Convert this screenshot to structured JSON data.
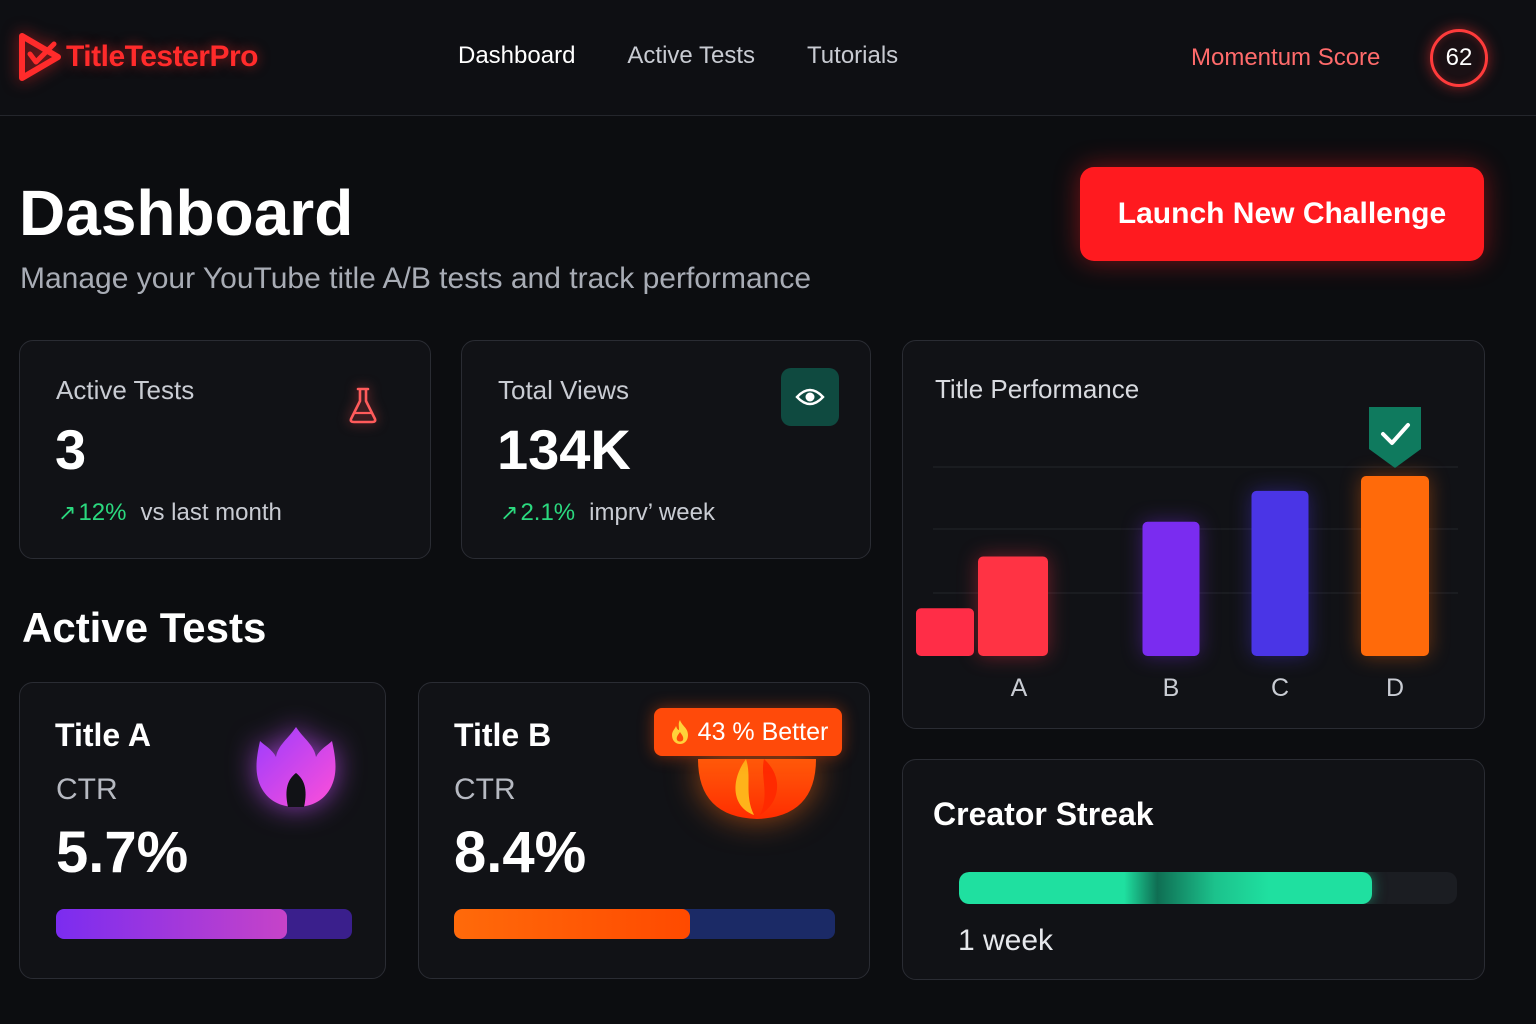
{
  "app": {
    "name": "TitleTesterPro",
    "brand_color": "#ff2b2b"
  },
  "nav": {
    "items": [
      {
        "label": "Dashboard",
        "active": true
      },
      {
        "label": "Active Tests",
        "active": false
      },
      {
        "label": "Tutorials",
        "active": false
      }
    ],
    "momentum_label": "Momentum Score",
    "momentum_value": "62"
  },
  "header": {
    "title": "Dashboard",
    "subtitle": "Manage your YouTube title A/B tests and track performance",
    "cta_label": "Launch New Challenge"
  },
  "stats": {
    "active_tests": {
      "label": "Active Tests",
      "value": "3",
      "change": "12%",
      "change_text": "vs last month",
      "icon": "flask-icon"
    },
    "total_views": {
      "label": "Total Views",
      "value": "134K",
      "change": "2.1%",
      "change_text": "imprv’ week",
      "icon": "eye-icon"
    }
  },
  "active_tests_section": {
    "title": "Active Tests",
    "tests": [
      {
        "title": "Title A",
        "ctr_label": "CTR",
        "ctr": "5.7%",
        "progress": 0.78,
        "icon": "flame-icon"
      },
      {
        "title": "Title B",
        "ctr_label": "CTR",
        "ctr": "8.4%",
        "progress": 0.62,
        "badge": "43 % Better",
        "icon": "fire-icon"
      }
    ]
  },
  "chart_data": {
    "type": "bar",
    "title": "Title Performance",
    "categories": [
      "A",
      "B",
      "C",
      "D"
    ],
    "values": [
      100,
      135,
      166,
      181
    ],
    "winner": "D",
    "grid": true,
    "colors": [
      "#ff3344",
      "#7a2cf0",
      "#4a35e6",
      "#ff6a0a"
    ]
  },
  "streak": {
    "title": "Creator Streak",
    "label": "1 week",
    "progress": 0.83
  }
}
